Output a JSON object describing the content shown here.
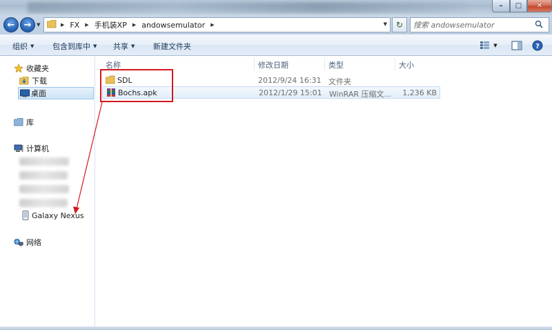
{
  "window": {
    "minimize_glyph": "–",
    "maximize_glyph": "□",
    "close_glyph": "✕"
  },
  "address": {
    "crumbs": [
      "FX",
      "手机装XP",
      "andowsemulator"
    ],
    "search_placeholder": "搜索 andowsemulator"
  },
  "toolbar": {
    "organize_label": "组织",
    "include_library_label": "包含到库中",
    "share_label": "共享",
    "new_folder_label": "新建文件夹"
  },
  "sidebar": {
    "favorites_label": "收藏夹",
    "downloads_label": "下载",
    "desktop_label": "桌面",
    "libraries_label": "库",
    "computer_label": "计算机",
    "device_label": "Galaxy Nexus",
    "network_label": "网络"
  },
  "columns": {
    "name": "名称",
    "modified": "修改日期",
    "type": "类型",
    "size": "大小"
  },
  "files": [
    {
      "name": "SDL",
      "modified": "2012/9/24 16:31",
      "type": "文件夹",
      "size": "",
      "icon": "folder-icon"
    },
    {
      "name": "Bochs.apk",
      "modified": "2012/1/29 15:01",
      "type": "WinRAR 压缩文...",
      "size": "1,236 KB",
      "icon": "winrar-archive-icon"
    }
  ],
  "colors": {
    "annotation": "#d4161e",
    "accent": "#2866b8"
  }
}
